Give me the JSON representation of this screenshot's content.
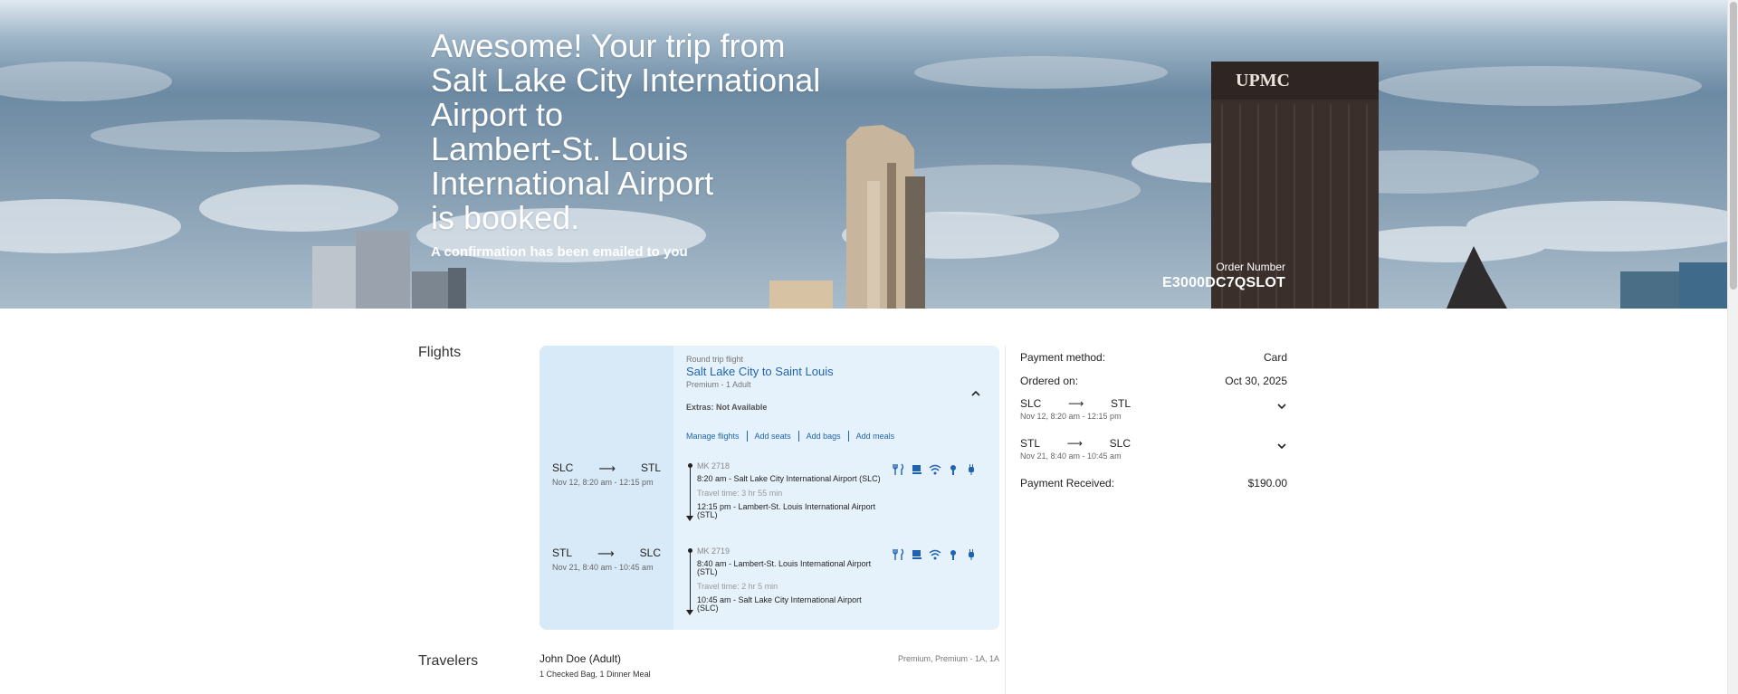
{
  "hero": {
    "title_lines": [
      "Awesome! Your trip from",
      "Salt Lake City International",
      "Airport to",
      "Lambert-St. Louis",
      "International Airport",
      "is booked."
    ],
    "subtitle": "A confirmation has been emailed to you",
    "order_label": "Order Number",
    "order_number": "E3000DC7QSLOT",
    "building_sign": "UPMC"
  },
  "flights": {
    "section_label": "Flights",
    "trip_type": "Round trip flight",
    "trip_name": "Salt Lake City to Saint Louis",
    "trip_class": "Premium - 1 Adult",
    "extras": "Extras: Not Available",
    "actions": [
      "Manage flights",
      "Add seats",
      "Add bags",
      "Add meals"
    ],
    "segments": [
      {
        "from": "SLC",
        "to": "STL",
        "arrow": "⟶",
        "date": "Nov 12, 8:20 am - 12:15 pm",
        "flight_no": "MK 2718",
        "depart": "8:20 am - Salt Lake City International Airport (SLC)",
        "travel_time": "Travel time: 3 hr 55 min",
        "arrive_line1": "12:15 pm - Lambert-St. Louis International Airport",
        "arrive_line2": "(STL)"
      },
      {
        "from": "STL",
        "to": "SLC",
        "arrow": "⟶",
        "date": "Nov 21, 8:40 am - 10:45 am",
        "flight_no": "MK 2719",
        "depart_line1": "8:40 am - Lambert-St. Louis International Airport",
        "depart_line2": "(STL)",
        "travel_time": "Travel time: 2 hr 5 min",
        "arrive_line1": "10:45 am - Salt Lake City International Airport",
        "arrive_line2": "(SLC)"
      }
    ],
    "amenity_icons": [
      "meal-icon",
      "drink-icon",
      "wifi-icon",
      "entertainment-icon",
      "power-icon"
    ]
  },
  "payment": {
    "method_label": "Payment method:",
    "method_value": "Card",
    "ordered_label": "Ordered on:",
    "ordered_value": "Oct 30, 2025",
    "segments": [
      {
        "from": "SLC",
        "to": "STL",
        "arrow": "⟶",
        "date": "Nov 12, 8:20 am - 12:15 pm"
      },
      {
        "from": "STL",
        "to": "SLC",
        "arrow": "⟶",
        "date": "Nov 21, 8:40 am - 10:45 am"
      }
    ],
    "received_label": "Payment Received:",
    "received_value": "$190.00"
  },
  "travelers": {
    "section_label": "Travelers",
    "name": "John Doe (Adult)",
    "extras": "1 Checked Bag, 1 Dinner Meal",
    "seat": "Premium, Premium - 1A, 1A"
  },
  "colors": {
    "link": "#1f63b0",
    "card_bg": "#dceefa",
    "card_left_bg": "#d8eaf8"
  }
}
